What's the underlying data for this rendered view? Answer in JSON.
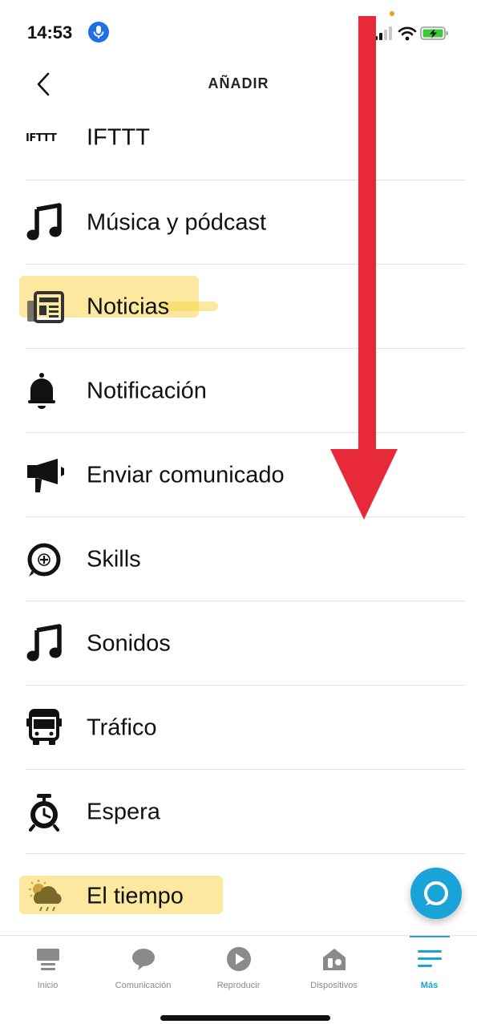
{
  "status_bar": {
    "time": "14:53"
  },
  "header": {
    "title": "AÑADIR"
  },
  "items": [
    {
      "label": "IFTTT",
      "logo_text": "IFTTT",
      "icon": "ifttt-logo"
    },
    {
      "label": "Música y pódcast",
      "icon": "music-note-icon"
    },
    {
      "label": "Noticias",
      "icon": "newspaper-icon",
      "highlighted": true
    },
    {
      "label": "Notificación",
      "icon": "bell-icon"
    },
    {
      "label": "Enviar comunicado",
      "icon": "megaphone-icon"
    },
    {
      "label": "Skills",
      "icon": "skills-plus-icon"
    },
    {
      "label": "Sonidos",
      "icon": "music-note-icon"
    },
    {
      "label": "Tráfico",
      "icon": "bus-icon"
    },
    {
      "label": "Espera",
      "icon": "alarm-clock-icon"
    },
    {
      "label": "El tiempo",
      "icon": "weather-icon",
      "highlighted": true
    }
  ],
  "bottom_nav": [
    {
      "label": "Inicio",
      "icon": "home-icon"
    },
    {
      "label": "Comunicación",
      "icon": "chat-bubble-icon"
    },
    {
      "label": "Reproducir",
      "icon": "play-icon"
    },
    {
      "label": "Dispositivos",
      "icon": "devices-icon"
    },
    {
      "label": "Más",
      "icon": "menu-icon",
      "active": true
    }
  ],
  "colors": {
    "accent": "#1aa3d9",
    "highlight": "#fad650",
    "arrow": "#e8293a",
    "mic": "#1f6fe5"
  }
}
